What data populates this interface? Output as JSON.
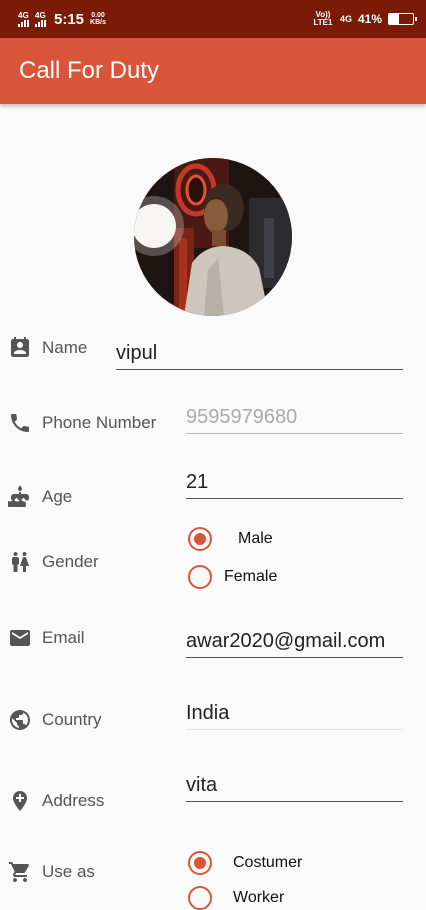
{
  "status": {
    "network1": "4G",
    "network2": "4G",
    "time": "5:15",
    "speed_value": "0.00",
    "speed_unit": "KB/s",
    "volte": "Vo)) LTE1",
    "network3": "4G",
    "battery": "41%",
    "battery_level": 0.41
  },
  "app_bar": {
    "title": "Call For Duty"
  },
  "colors": {
    "accent": "#d9553a",
    "status_bar": "#7a1b08"
  },
  "form": {
    "name": {
      "label": "Name",
      "value": "vipul",
      "icon": "contact-card-icon"
    },
    "phone": {
      "label": "Phone Number",
      "placeholder": "9595979680",
      "icon": "phone-icon"
    },
    "age": {
      "label": "Age",
      "value": "21",
      "icon": "cake-icon"
    },
    "gender": {
      "label": "Gender",
      "icon": "people-icon",
      "options": [
        {
          "label": "Male",
          "selected": true
        },
        {
          "label": "Female",
          "selected": false
        }
      ]
    },
    "email": {
      "label": "Email",
      "value": "awar2020@gmail.com",
      "icon": "mail-icon"
    },
    "country": {
      "label": "Country",
      "value": "India",
      "icon": "globe-icon"
    },
    "address": {
      "label": "Address",
      "value": "vita",
      "icon": "location-pin-icon"
    },
    "use_as": {
      "label": "Use as",
      "icon": "cart-icon",
      "options": [
        {
          "label": "Costumer",
          "selected": true
        },
        {
          "label": "Worker",
          "selected": false
        }
      ]
    }
  }
}
